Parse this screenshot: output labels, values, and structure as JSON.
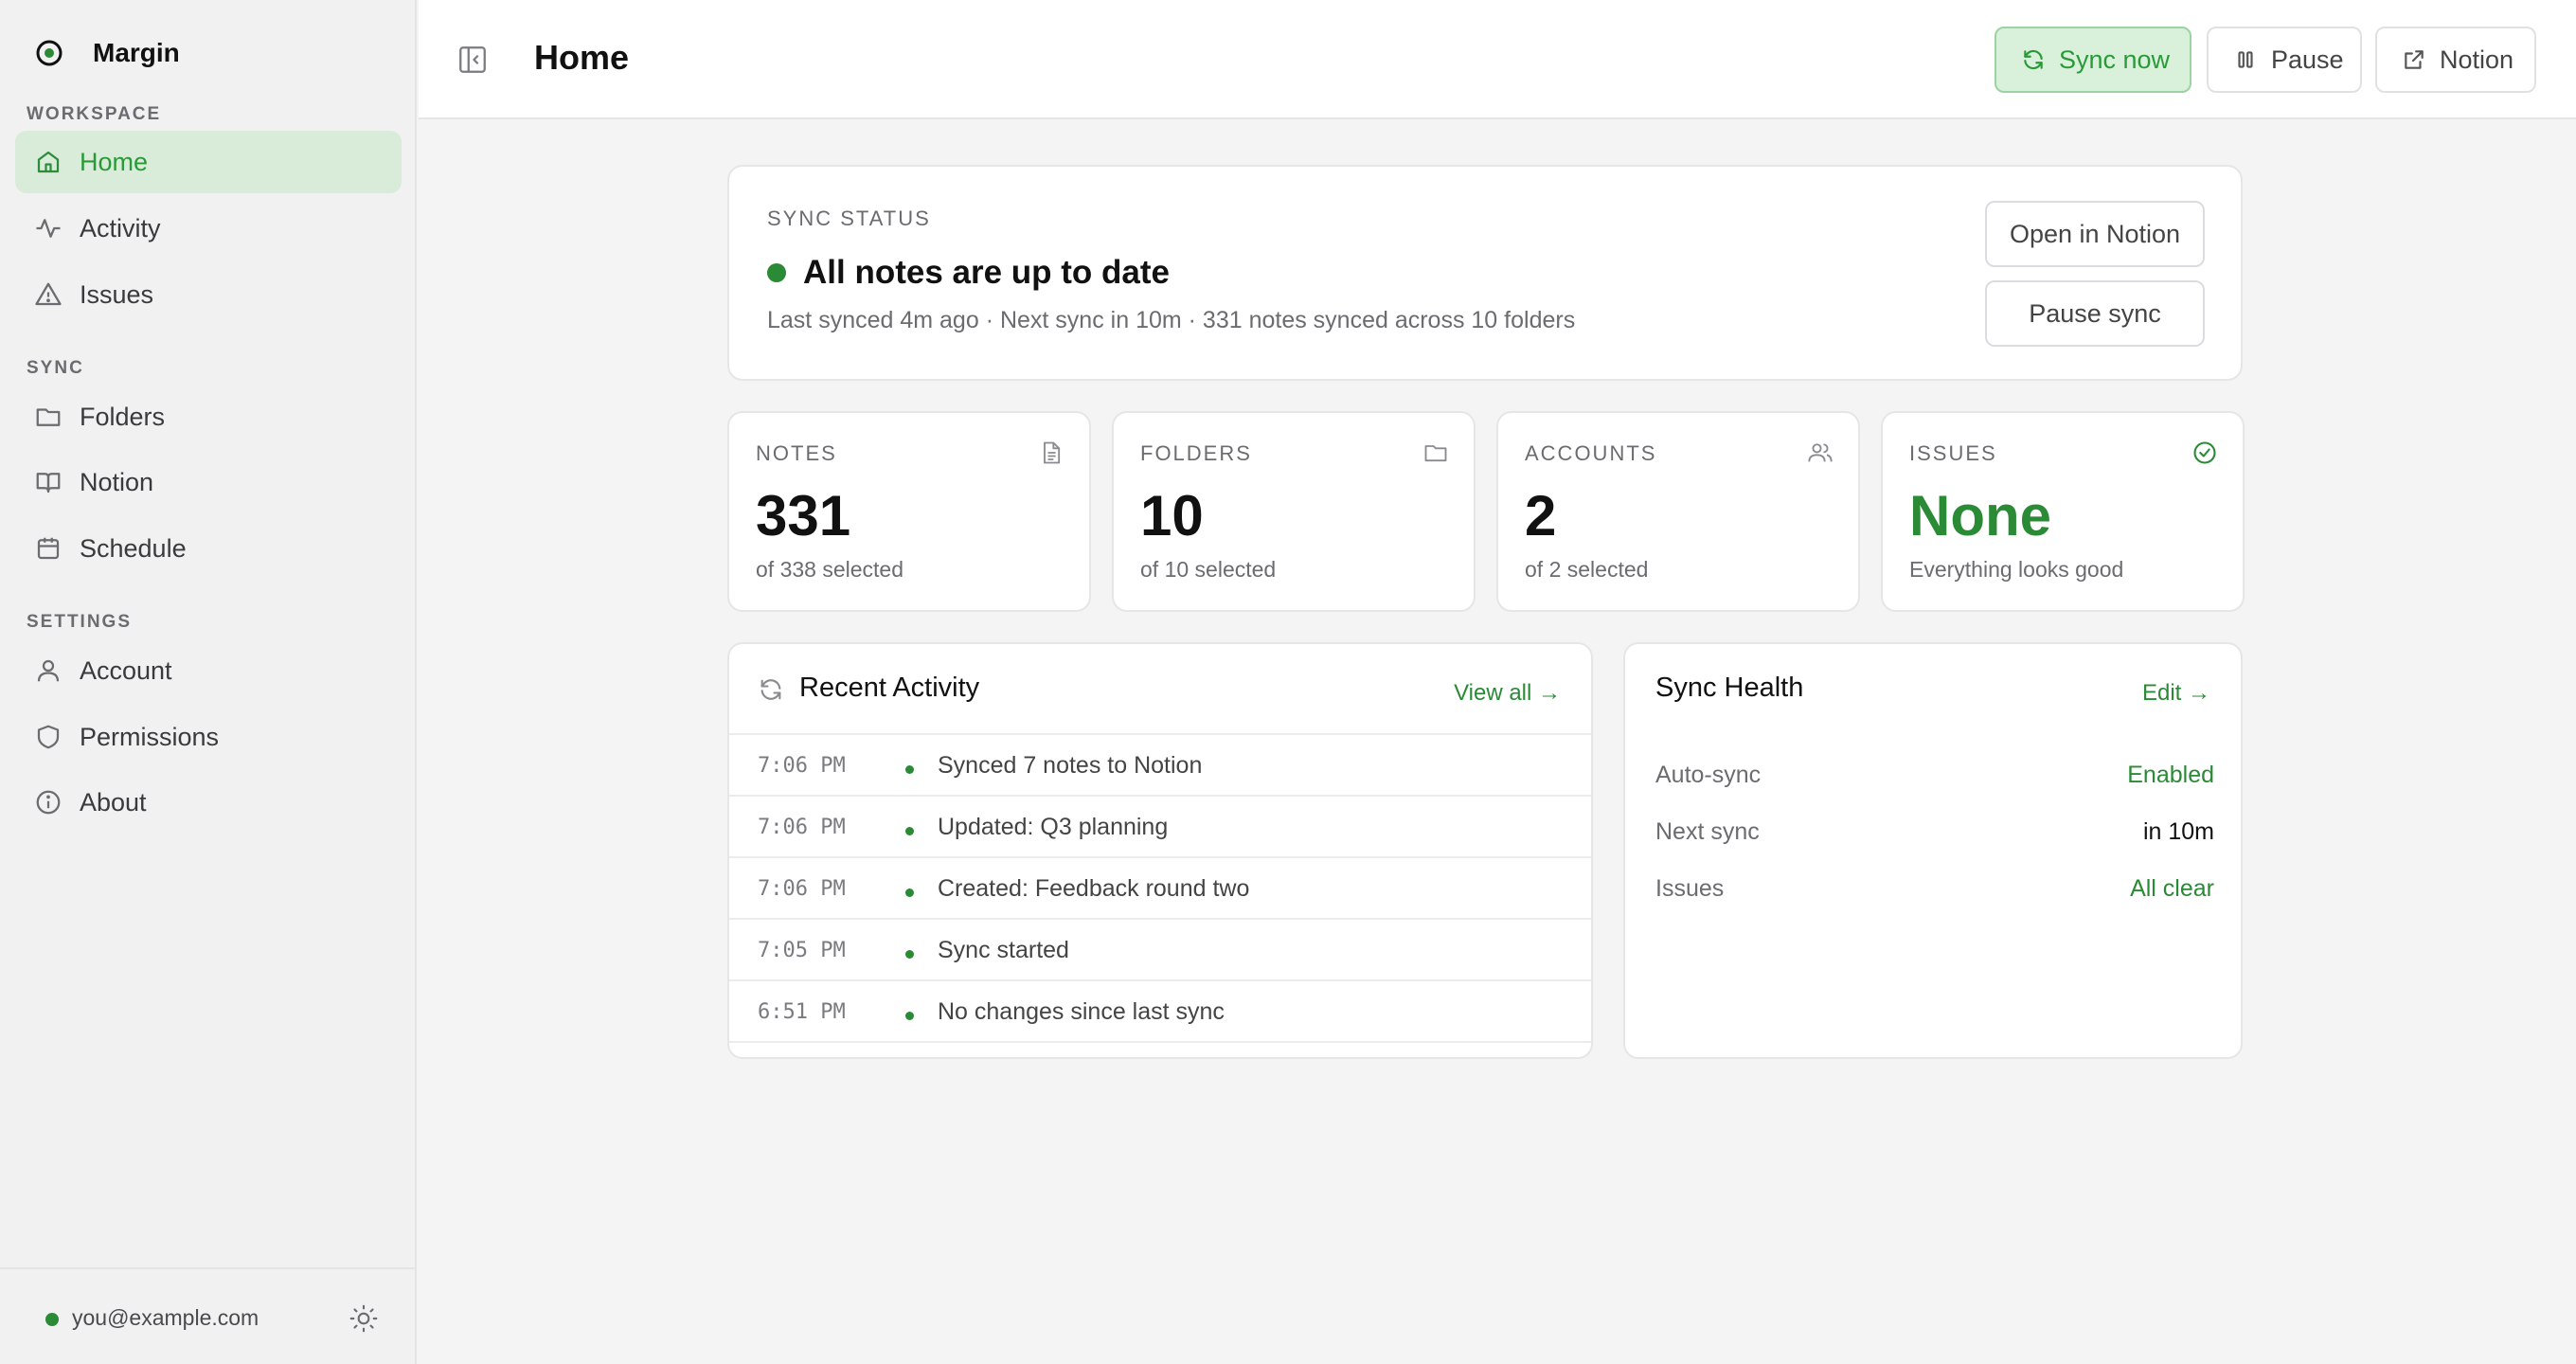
{
  "app": {
    "name": "Margin"
  },
  "sidebar": {
    "sections": [
      {
        "label": "WORKSPACE"
      },
      {
        "label": "SYNC"
      },
      {
        "label": "SETTINGS"
      }
    ],
    "items": [
      {
        "label": "Home",
        "icon": "home-icon",
        "active": true
      },
      {
        "label": "Activity",
        "icon": "activity-icon"
      },
      {
        "label": "Issues",
        "icon": "warning-icon"
      },
      {
        "label": "Folders",
        "icon": "folder-icon"
      },
      {
        "label": "Notion",
        "icon": "book-icon"
      },
      {
        "label": "Schedule",
        "icon": "calendar-icon"
      },
      {
        "label": "Account",
        "icon": "user-icon"
      },
      {
        "label": "Permissions",
        "icon": "shield-icon"
      },
      {
        "label": "About",
        "icon": "info-icon"
      }
    ],
    "footer": {
      "email": "you@example.com"
    }
  },
  "header": {
    "title": "Home",
    "buttons": {
      "sync": "Sync now",
      "pause": "Pause",
      "notion": "Notion"
    }
  },
  "status": {
    "label": "SYNC STATUS",
    "headline": "All notes are up to date",
    "details": "Last synced 4m ago · Next sync in 10m · 331 notes synced across 10 folders",
    "buttons": {
      "open": "Open in Notion",
      "pause": "Pause sync"
    }
  },
  "stats": [
    {
      "label": "NOTES",
      "value": "331",
      "sub": "of 338 selected",
      "icon": "document-icon"
    },
    {
      "label": "FOLDERS",
      "value": "10",
      "sub": "of 10 selected",
      "icon": "folder-icon"
    },
    {
      "label": "ACCOUNTS",
      "value": "2",
      "sub": "of 2 selected",
      "icon": "users-icon"
    },
    {
      "label": "ISSUES",
      "value": "None",
      "sub": "Everything looks good",
      "icon": "check-circle-icon"
    }
  ],
  "activity": {
    "title": "Recent Activity",
    "link": "View all →",
    "rows": [
      {
        "time": "7:06 PM",
        "text": "Synced 7 notes to Notion"
      },
      {
        "time": "7:06 PM",
        "text": "Updated: Q3 planning"
      },
      {
        "time": "7:06 PM",
        "text": "Created: Feedback round two"
      },
      {
        "time": "7:05 PM",
        "text": "Sync started"
      },
      {
        "time": "6:51 PM",
        "text": "No changes since last sync"
      }
    ]
  },
  "health": {
    "title": "Sync Health",
    "link": "Edit →",
    "rows": [
      {
        "key": "Auto-sync",
        "value": "Enabled"
      },
      {
        "key": "Next sync",
        "value": "in 10m"
      },
      {
        "key": "Issues",
        "value": "All clear"
      }
    ]
  },
  "colors": {
    "accent": "#2a8a36",
    "accent_bg": "#d8ecd9",
    "sidebar_bg": "#f1f1f2",
    "page_bg": "#f4f4f4"
  }
}
